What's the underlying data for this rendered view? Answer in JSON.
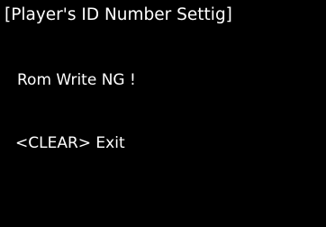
{
  "screen": {
    "title": "[Player's ID Number Settig]",
    "message": "Rom Write NG !",
    "hint": "<CLEAR> Exit"
  },
  "colors": {
    "background": "#000000",
    "text": "#ffffff"
  }
}
